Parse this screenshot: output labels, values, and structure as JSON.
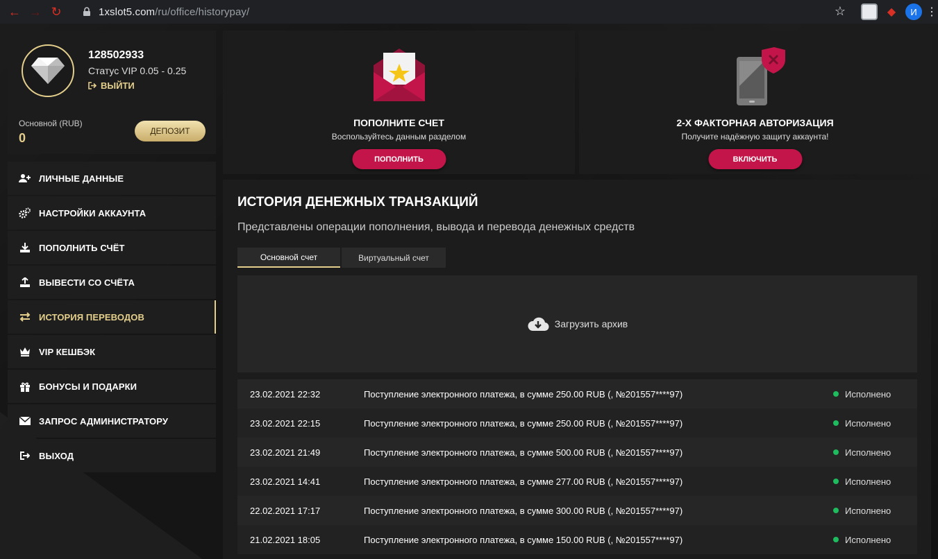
{
  "browser": {
    "url_host": "1xslot5.com",
    "url_path": "/ru/office/historypay/",
    "profile_initial": "И"
  },
  "profile": {
    "user_id": "128502933",
    "vip_status": "Статус VIP 0.05 - 0.25",
    "logout_label": "ВЫЙТИ",
    "balance_label": "Основной (RUB)",
    "balance_value": "0",
    "deposit_label": "ДЕПОЗИТ"
  },
  "menu": {
    "items": [
      {
        "label": "ЛИЧНЫЕ ДАННЫЕ",
        "icon": "user-add-icon"
      },
      {
        "label": "НАСТРОЙКИ АККАУНТА",
        "icon": "gears-icon"
      },
      {
        "label": "ПОПОЛНИТЬ СЧЁТ",
        "icon": "download-tray-icon"
      },
      {
        "label": "ВЫВЕСТИ СО СЧЁТА",
        "icon": "upload-tray-icon"
      },
      {
        "label": "ИСТОРИЯ ПЕРЕВОДОВ",
        "icon": "transfer-arrows-icon",
        "active": true
      },
      {
        "label": "VIP КЕШБЭК",
        "icon": "crown-icon"
      },
      {
        "label": "БОНУСЫ И ПОДАРКИ",
        "icon": "gift-icon"
      },
      {
        "label": "ЗАПРОС АДМИНИСТРАТОРУ",
        "icon": "envelope-icon"
      },
      {
        "label": "ВЫХОД",
        "icon": "logout-icon"
      }
    ]
  },
  "cards": {
    "deposit": {
      "title": "ПОПОЛНИТЕ СЧЕТ",
      "subtitle": "Воспользуйтесь данным разделом",
      "button": "ПОПОЛНИТЬ"
    },
    "twofa": {
      "title": "2-Х ФАКТОРНАЯ АВТОРИЗАЦИЯ",
      "subtitle": "Получите надёжную защиту аккаунта!",
      "button": "ВКЛЮЧИТЬ"
    }
  },
  "history": {
    "title": "ИСТОРИЯ ДЕНЕЖНЫХ ТРАНЗАКЦИЙ",
    "subtitle": "Представлены операции пополнения, вывода и перевода денежных средств",
    "tabs": [
      "Основной счет",
      "Виртуальный счет"
    ],
    "archive_label": "Загрузить архив",
    "transactions": [
      {
        "date": "23.02.2021 22:32",
        "description": "Поступление электронного платежа, в сумме 250.00 RUB (, №201557****97)",
        "status": "Исполнено"
      },
      {
        "date": "23.02.2021 22:15",
        "description": "Поступление электронного платежа, в сумме 250.00 RUB (, №201557****97)",
        "status": "Исполнено"
      },
      {
        "date": "23.02.2021 21:49",
        "description": "Поступление электронного платежа, в сумме 500.00 RUB (, №201557****97)",
        "status": "Исполнено"
      },
      {
        "date": "23.02.2021 14:41",
        "description": "Поступление электронного платежа, в сумме 277.00 RUB (, №201557****97)",
        "status": "Исполнено"
      },
      {
        "date": "22.02.2021 17:17",
        "description": "Поступление электронного платежа, в сумме 300.00 RUB (, №201557****97)",
        "status": "Исполнено"
      },
      {
        "date": "21.02.2021 18:05",
        "description": "Поступление электронного платежа, в сумме 150.00 RUB (, №201557****97)",
        "status": "Исполнено"
      }
    ]
  },
  "colors": {
    "accent_gold": "#e5cf8c",
    "button_red": "#c4154a",
    "status_green": "#1ebc5e"
  }
}
